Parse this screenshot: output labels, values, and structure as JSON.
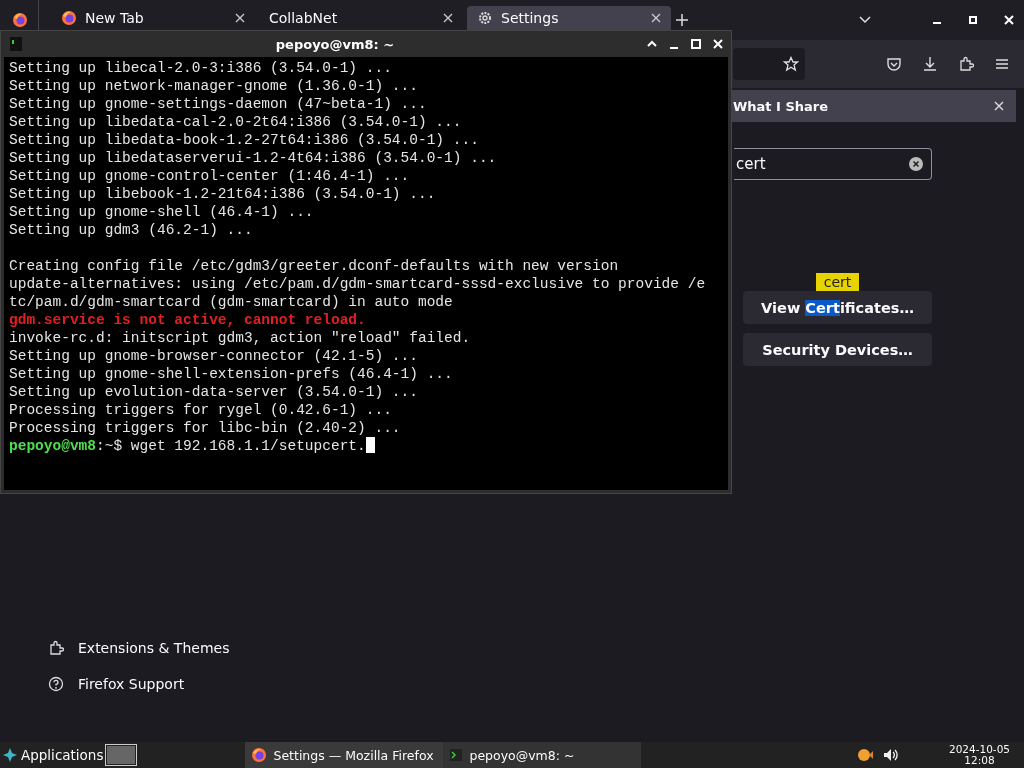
{
  "browser": {
    "tabs": [
      {
        "label": "New Tab",
        "selected": false
      },
      {
        "label": "CollabNet",
        "selected": false
      },
      {
        "label": "Settings",
        "selected": true
      }
    ],
    "notification": {
      "text": "What I Share"
    },
    "search": {
      "value": "cert"
    },
    "tooltip": "cert",
    "buttons": [
      {
        "parts": [
          {
            "text": "View ",
            "highlighted": false
          },
          {
            "text": "Cert",
            "highlighted": true
          },
          {
            "text": "ificates…",
            "highlighted": false
          }
        ]
      },
      {
        "parts": [
          {
            "text": "Security Devices…",
            "highlighted": false
          }
        ]
      }
    ],
    "sidebar_links": [
      {
        "label": "Extensions & Themes"
      },
      {
        "label": "Firefox Support"
      }
    ]
  },
  "terminal": {
    "title": "pepoyo@vm8: ~",
    "lines": [
      {
        "kind": "text",
        "text": "Setting up libecal-2.0-3:i386 (3.54.0-1) ..."
      },
      {
        "kind": "text",
        "text": "Setting up network-manager-gnome (1.36.0-1) ..."
      },
      {
        "kind": "text",
        "text": "Setting up gnome-settings-daemon (47~beta-1) ..."
      },
      {
        "kind": "text",
        "text": "Setting up libedata-cal-2.0-2t64:i386 (3.54.0-1) ..."
      },
      {
        "kind": "text",
        "text": "Setting up libedata-book-1.2-27t64:i386 (3.54.0-1) ..."
      },
      {
        "kind": "text",
        "text": "Setting up libedataserverui-1.2-4t64:i386 (3.54.0-1) ..."
      },
      {
        "kind": "text",
        "text": "Setting up gnome-control-center (1:46.4-1) ..."
      },
      {
        "kind": "text",
        "text": "Setting up libebook-1.2-21t64:i386 (3.54.0-1) ..."
      },
      {
        "kind": "text",
        "text": "Setting up gnome-shell (46.4-1) ..."
      },
      {
        "kind": "text",
        "text": "Setting up gdm3 (46.2-1) ..."
      },
      {
        "kind": "blank"
      },
      {
        "kind": "text",
        "text": "Creating config file /etc/gdm3/greeter.dconf-defaults with new version"
      },
      {
        "kind": "text",
        "text": "update-alternatives: using /etc/pam.d/gdm-smartcard-sssd-exclusive to provide /e"
      },
      {
        "kind": "text",
        "text": "tc/pam.d/gdm-smartcard (gdm-smartcard) in auto mode"
      },
      {
        "kind": "error",
        "text": "gdm.service is not active, cannot reload."
      },
      {
        "kind": "text",
        "text": "invoke-rc.d: initscript gdm3, action \"reload\" failed."
      },
      {
        "kind": "text",
        "text": "Setting up gnome-browser-connector (42.1-5) ..."
      },
      {
        "kind": "text",
        "text": "Setting up gnome-shell-extension-prefs (46.4-1) ..."
      },
      {
        "kind": "text",
        "text": "Setting up evolution-data-server (3.54.0-1) ..."
      },
      {
        "kind": "text",
        "text": "Processing triggers for rygel (0.42.6-1) ..."
      },
      {
        "kind": "text",
        "text": "Processing triggers for libc-bin (2.40-2) ..."
      },
      {
        "kind": "prompt",
        "user": "pepoyo@vm8",
        "path": ":~$",
        "text": "wget 192.168.1.1/setupcert."
      }
    ]
  },
  "taskbar": {
    "menu": "Applications",
    "tasks": [
      {
        "label": "Settings — Mozilla Firefox"
      },
      {
        "label": "pepoyo@vm8: ~"
      }
    ],
    "date": "2024-10-05",
    "time": "12:08"
  }
}
